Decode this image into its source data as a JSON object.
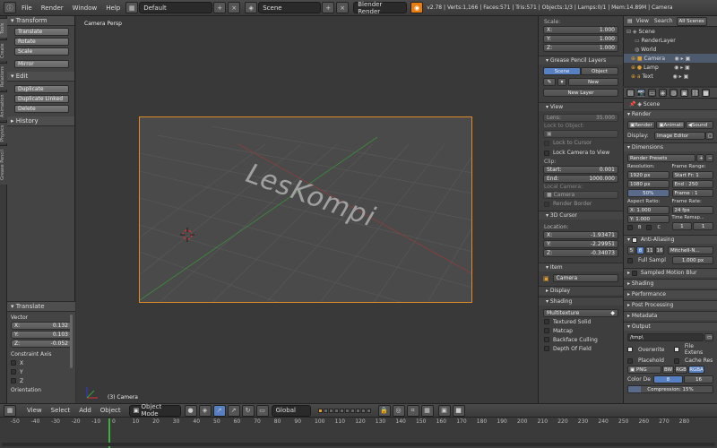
{
  "topbar": {
    "menus": [
      "File",
      "Render",
      "Window",
      "Help"
    ],
    "layout": "Default",
    "scene": "Scene",
    "engine": "Blender Render",
    "stats": "v2.78 | Verts:1,166 | Faces:571 | Tris:571 | Objects:1/3 | Lamps:0/1 | Mem:14.89M | Camera"
  },
  "lefttabs": [
    "Tools",
    "Create",
    "Relations",
    "Animation",
    "Physics",
    "Grease Pencil"
  ],
  "toolshelf": {
    "transform_title": "Transform",
    "transform_buttons": [
      "Translate",
      "Rotate",
      "Scale"
    ],
    "mirror": "Mirror",
    "edit_title": "Edit",
    "edit_buttons": [
      "Duplicate",
      "Duplicate Linked",
      "Delete"
    ],
    "history_title": "History"
  },
  "operator": {
    "title": "Translate",
    "vector_label": "Vector",
    "x_label": "X:",
    "x": "0.132",
    "y_label": "Y:",
    "y": "0.103",
    "z_label": "Z:",
    "z": "-0.052",
    "constraint_label": "Constraint Axis",
    "axes": [
      "X",
      "Y",
      "Z"
    ],
    "orientation_label": "Orientation"
  },
  "viewport": {
    "title": "Camera Persp",
    "object_label": "(3) Camera",
    "watermark": "LesKompi"
  },
  "npanel": {
    "scale_label": "Scale:",
    "scale": [
      {
        "k": "X:",
        "v": "1.000"
      },
      {
        "k": "Y:",
        "v": "1.000"
      },
      {
        "k": "Z:",
        "v": "1.000"
      }
    ],
    "gp_title": "Grease Pencil Layers",
    "gp_scene": "Scene",
    "gp_object": "Object",
    "gp_new": "New",
    "gp_new_layer": "New Layer",
    "view_title": "View",
    "lens_label": "Lens:",
    "lens": "35.000",
    "lock_object": "Lock to Object:",
    "lock_cursor": "Lock to Cursor",
    "lock_camera": "Lock Camera to View",
    "clip_label": "Clip:",
    "clip_start_label": "Start:",
    "clip_start": "0.001",
    "clip_end_label": "End:",
    "clip_end": "1000.000",
    "local_camera": "Local Camera:",
    "camera_field": "Camera",
    "render_border": "Render Border",
    "cursor_title": "3D Cursor",
    "location_label": "Location:",
    "cursor": [
      {
        "k": "X:",
        "v": "-1.93471"
      },
      {
        "k": "Y:",
        "v": "-2.29951"
      },
      {
        "k": "Z:",
        "v": "-0.34073"
      }
    ],
    "item_title": "Item",
    "item_name": "Camera",
    "display_title": "Display",
    "shading_title": "Shading",
    "shading_mode": "Multitexture",
    "shading_opts": [
      "Textured Solid",
      "Matcap",
      "Backface Culling",
      "Depth Of Field"
    ]
  },
  "outliner": {
    "view": "View",
    "search": "Search",
    "all_scenes": "All Scenes",
    "rows": [
      "Scene",
      "RenderLayer",
      "World",
      "Camera",
      "Lamp",
      "Text"
    ]
  },
  "props": {
    "scene": "Scene",
    "render_title": "Render",
    "render_btn": "Render",
    "anim_btn": "Animati",
    "sound_btn": "Sound",
    "display_label": "Display:",
    "display_value": "Image Editor",
    "dimensions_title": "Dimensions",
    "presets": "Render Presets",
    "resolution_label": "Resolution:",
    "frame_range_label": "Frame Range:",
    "res_x": "1920 px",
    "res_y": "1080 px",
    "res_pct": "50%",
    "start_frame": "Start Fr: 1",
    "end_frame": "End : 250",
    "frame_step": "Frame : 1",
    "aspect_label": "Aspect Ratio:",
    "frame_rate_label": "Frame Rate:",
    "aspect_x": "X: 1.000",
    "aspect_y": "Y: 1.000",
    "fps": "24 fps",
    "time_remap": "Time Remap...",
    "remap_a": "1",
    "remap_b": "1",
    "aa_title": "Anti-Aliasing",
    "aa_samples": [
      "5",
      "8",
      "11",
      "16"
    ],
    "aa_filter": "Mitchell-N...",
    "full_sample": "Full Sampl",
    "filter_size": "1.000 px",
    "motion_blur": "Sampled Motion Blur",
    "collapsed": [
      "Shading",
      "Performance",
      "Post Processing",
      "Metadata"
    ],
    "output_title": "Output",
    "output_path": "/tmp\\",
    "overwrite": "Overwrite",
    "file_ext": "File Extens",
    "placeholders": "Placehold",
    "cache": "Cache Res",
    "format": "PNG",
    "bw": "BW",
    "rgb": "RGB",
    "rgba": "RGBA",
    "color_depth_label": "Color De",
    "depth_8": "8",
    "depth_16": "16",
    "compression": "Compression: 15%"
  },
  "vpheader": {
    "view": "View",
    "select": "Select",
    "add": "Add",
    "object": "Object",
    "mode": "Object Mode",
    "orientation": "Global"
  },
  "timeline": {
    "ticks": [
      "-50",
      "-40",
      "-30",
      "-20",
      "-10",
      "0",
      "10",
      "20",
      "30",
      "40",
      "50",
      "60",
      "70",
      "80",
      "90",
      "100",
      "110",
      "120",
      "130",
      "140",
      "150",
      "160",
      "170",
      "180",
      "190",
      "200",
      "210",
      "220",
      "230",
      "240",
      "250",
      "260",
      "270",
      "280"
    ]
  }
}
